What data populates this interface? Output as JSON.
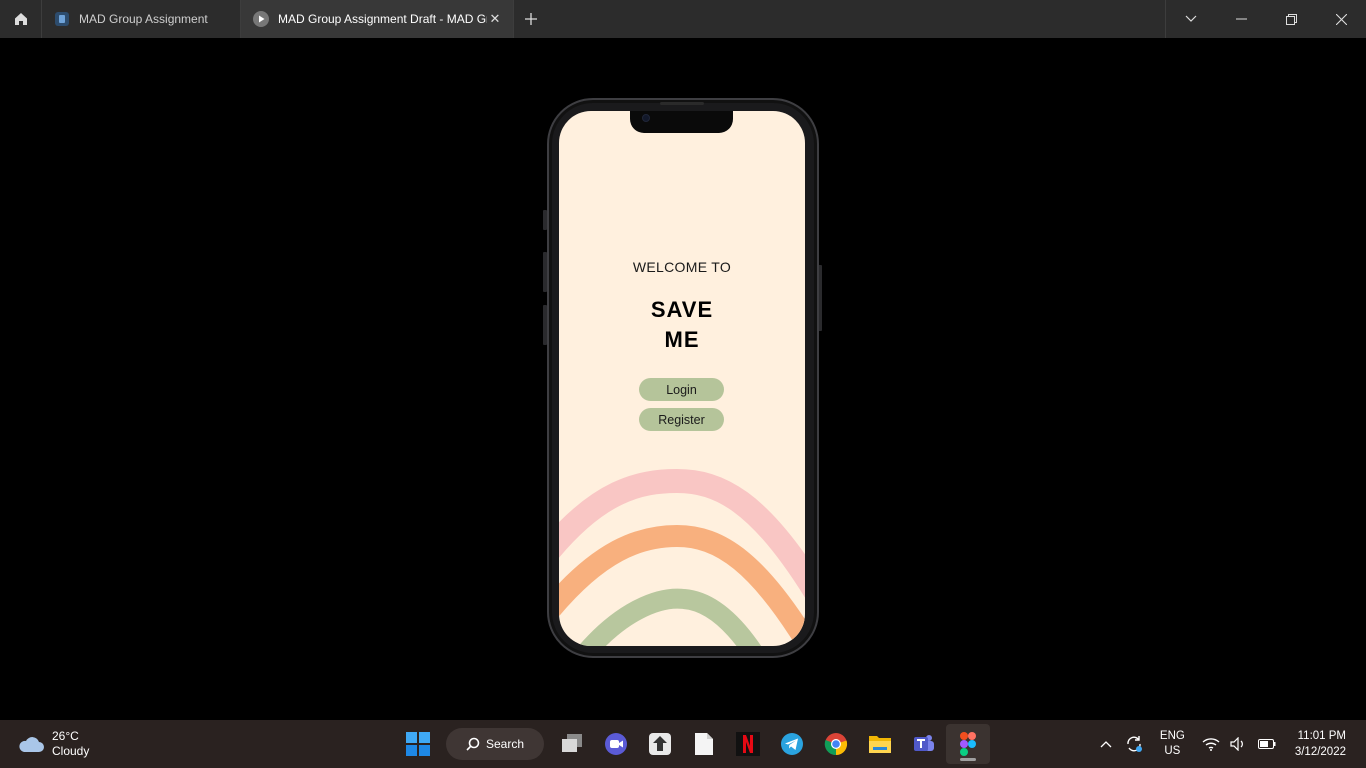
{
  "titlebar": {
    "tabs": [
      {
        "label": "MAD Group Assignment",
        "icon": "figma-file-icon"
      },
      {
        "label": "MAD Group Assignment Draft - MAD Gr",
        "icon": "play-icon",
        "active": true
      }
    ]
  },
  "prototype": {
    "welcome": "WELCOME TO",
    "brand_line1": "SAVE",
    "brand_line2": "ME",
    "login_label": "Login",
    "register_label": "Register",
    "colors": {
      "background": "#fff0de",
      "button": "#b5c49a",
      "arc_pink": "#f9c6c4",
      "arc_orange": "#f8b07e",
      "arc_green": "#b8c79e"
    }
  },
  "taskbar": {
    "weather_temp": "26°C",
    "weather_desc": "Cloudy",
    "search_label": "Search",
    "apps": [
      "start-icon",
      "search",
      "task-view-icon",
      "zoom-icon",
      "inkscape-icon",
      "file-icon",
      "netflix-icon",
      "telegram-icon",
      "chrome-icon",
      "file-explorer-icon",
      "teams-icon",
      "figma-icon"
    ],
    "lang_line1": "ENG",
    "lang_line2": "US",
    "time": "11:01 PM",
    "date": "3/12/2022"
  }
}
